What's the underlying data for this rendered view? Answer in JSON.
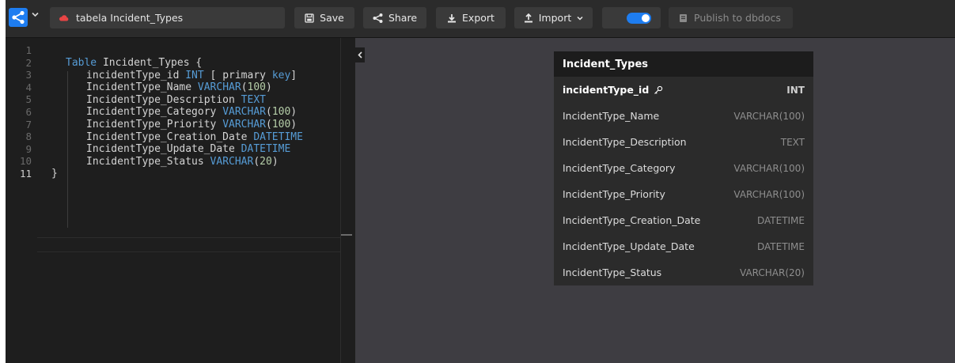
{
  "colors": {
    "accent": "#1e7df0",
    "cloud": "#e84545",
    "canvas": "#3e3d42"
  },
  "topbar": {
    "project_name": "tabela Incident_Types",
    "save_label": "Save",
    "share_label": "Share",
    "export_label": "Export",
    "import_label": "Import",
    "publish_label": "Publish to dbdocs",
    "icons": [
      "dbdiagram-logo-icon",
      "cloud-icon",
      "save-icon",
      "share-icon",
      "export-icon",
      "import-icon",
      "moon-icon",
      "dbdocs-icon"
    ]
  },
  "editor": {
    "line_numbers": [
      "1",
      "2",
      "3",
      "4",
      "5",
      "6",
      "7",
      "8",
      "9",
      "10",
      "11"
    ],
    "active_line": "11",
    "lines": {
      "l2_kw": "Table",
      "l2_rest": " Incident_Types {",
      "l3_name": "incidentType_id ",
      "l3_type": "INT",
      "l3_rest": " [ primary ",
      "l3_key": "key",
      "l3_end": "]",
      "l4_name": "IncidentType_Name ",
      "l4_type": "VARCHAR",
      "l4_num": "100",
      "l5_name": "IncidentType_Description ",
      "l5_type": "TEXT",
      "l6_name": "IncidentType_Category ",
      "l6_type": "VARCHAR",
      "l6_num": "100",
      "l7_name": "IncidentType_Priority ",
      "l7_type": "VARCHAR",
      "l7_num": "100",
      "l8_name": "IncidentType_Creation_Date ",
      "l8_type": "DATETIME",
      "l9_name": "IncidentType_Update_Date ",
      "l9_type": "DATETIME",
      "l10_name": "IncidentType_Status ",
      "l10_type": "VARCHAR",
      "l10_num": "20",
      "l11": "}",
      "open_paren": "(",
      "close_paren": ")"
    }
  },
  "diagram": {
    "table_name": "Incident_Types",
    "fields": [
      {
        "name": "incidentType_id",
        "type": "INT",
        "pk": true
      },
      {
        "name": "IncidentType_Name",
        "type": "VARCHAR(100)"
      },
      {
        "name": "IncidentType_Description",
        "type": "TEXT"
      },
      {
        "name": "IncidentType_Category",
        "type": "VARCHAR(100)"
      },
      {
        "name": "IncidentType_Priority",
        "type": "VARCHAR(100)"
      },
      {
        "name": "IncidentType_Creation_Date",
        "type": "DATETIME"
      },
      {
        "name": "IncidentType_Update_Date",
        "type": "DATETIME"
      },
      {
        "name": "IncidentType_Status",
        "type": "VARCHAR(20)"
      }
    ]
  }
}
